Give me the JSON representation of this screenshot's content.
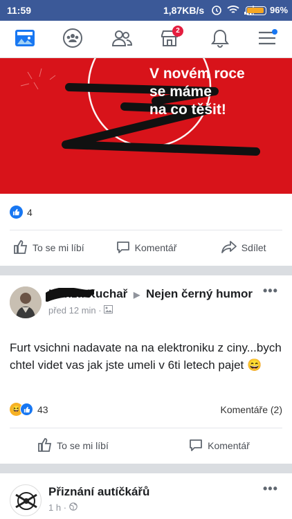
{
  "status_bar": {
    "time": "11:59",
    "speed": "1,87KB/s",
    "battery_percent": "96%",
    "battery_level": 0.96,
    "icons": [
      "alarm-icon",
      "wifi-icon",
      "signal-icon",
      "battery-icon"
    ]
  },
  "nav": {
    "items": [
      {
        "name": "news-feed-icon"
      },
      {
        "name": "groups-icon"
      },
      {
        "name": "friends-icon"
      },
      {
        "name": "marketplace-icon",
        "badge": "2"
      },
      {
        "name": "notifications-icon"
      },
      {
        "name": "menu-icon"
      }
    ],
    "accent": "#1877f2"
  },
  "post1": {
    "image_text": [
      "V novém roce",
      "se máme",
      "na co těšit!"
    ],
    "image_color": "#d8131a",
    "like_count": "4",
    "actions": {
      "like": "To se mi líbí",
      "comment": "Komentář",
      "share": "Sdílet"
    }
  },
  "post2": {
    "author": "Honza Kuchař",
    "target_group": "Nejen černý humor",
    "time": "před 12 min",
    "text": "Furt vsichni nadavate na na elektroniku z ciny...bych chtel videt vas jak jste umeli v 6ti letech pajet 😄",
    "reaction_count": "43",
    "comments": "Komentáře (2)",
    "actions": {
      "like": "To se mi líbí",
      "comment": "Komentář"
    }
  },
  "post3": {
    "author": "Přiznání autíčkářů",
    "time": "1 h"
  }
}
